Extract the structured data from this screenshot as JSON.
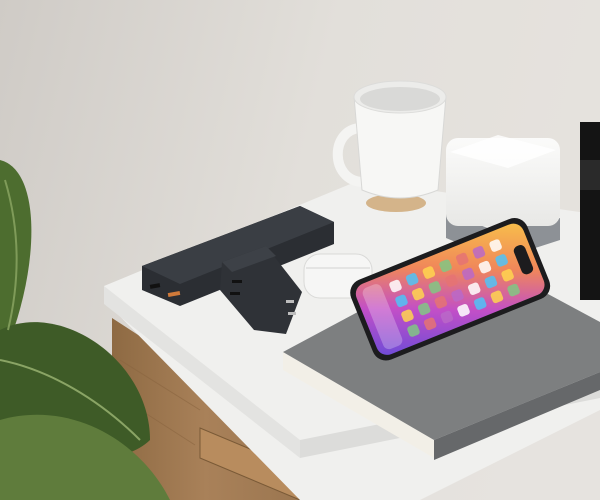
{
  "scene": {
    "objects": [
      {
        "name": "wall",
        "color": "#dedbd6"
      },
      {
        "name": "side-table",
        "color": "#f1f1ef"
      },
      {
        "name": "wooden-drawer",
        "color": "#a27a4f"
      },
      {
        "name": "power-bank",
        "color": "#26292d"
      },
      {
        "name": "usb-c-charger",
        "color": "#2e3136"
      },
      {
        "name": "earbuds-case",
        "color": "#f4f4f4"
      },
      {
        "name": "mug",
        "color": "#f7f7f5"
      },
      {
        "name": "cork-coaster",
        "color": "#d2b48c"
      },
      {
        "name": "cube-lamp",
        "color": "#f4f4f2"
      },
      {
        "name": "notebook",
        "color": "#7b7d7e"
      },
      {
        "name": "smartphone",
        "color": "#1b1b1d"
      },
      {
        "name": "camera-lens",
        "color": "#151515"
      },
      {
        "name": "plant-leaves",
        "color": "#4f6a33"
      }
    ]
  }
}
